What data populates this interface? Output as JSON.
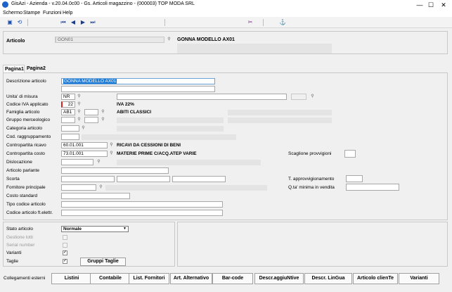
{
  "window": {
    "title": "GisAzi - Azienda - v.20.04.0c00 - Gs. Articoli magazzino - (000003) TOP MODA SRL",
    "minimize": "—",
    "maximize": "☐",
    "close": "✕"
  },
  "menu": [
    "Schermo",
    "Stampe",
    "Funzioni",
    "Help"
  ],
  "header": {
    "articolo_label": "Articolo",
    "articolo_code": "GON01",
    "articolo_desc": "GONNA MODELLO AX01"
  },
  "tabs": [
    "Pagina1",
    "Pagina2"
  ],
  "form": {
    "descrizione_label": "Descrizione articolo",
    "descrizione_value": "GONNA MODELLO AX01",
    "um_label": "Unita' di misura",
    "um_value": "NR",
    "iva_label": "Codice IVA applicato",
    "iva_value": "22",
    "iva_desc": "IVA 22%",
    "famiglia_label": "Famiglia articolo",
    "famiglia_value": "AB1",
    "famiglia_desc": "ABITI CLASSICI",
    "gruppo_label": "Gruppo merceologico",
    "categoria_label": "Categoria articolo",
    "raggruppamento_label": "Cod. raggruppamento",
    "ricavo_label": "Contropartita ricavo",
    "ricavo_value": "60.01.001",
    "ricavo_desc": "RICAVI DA CESSIONI DI BENI",
    "costo_label": "Contropartita costo",
    "costo_value": "73.01.001",
    "costo_desc": "MATERIE PRIME C/ACQ.ATEP VARIE",
    "scaglione_label": "Scaglione provvigioni",
    "dislocazione_label": "Dislocazione",
    "parlante_label": "Articolo parlante",
    "scorta_label": "Scorta",
    "approvvigionamento_label": "T. approvvigionamento",
    "fornitore_label": "Fornitore principale",
    "qta_minima_label": "Q.ta' minima in vendita",
    "costo_std_label": "Costo standard",
    "tipo_codice_label": "Tipo codice articolo",
    "codice_fe_label": "Codice articolo ft.elettr."
  },
  "bottom": {
    "stato_label": "Stato articolo",
    "stato_value": "Normale",
    "lotti_label": "Gestione lotti",
    "serial_label": "Serial number",
    "varianti_label": "Varianti",
    "taglie_label": "Taglie",
    "varianti_checked": "✓",
    "taglie_checked": "✓",
    "gruppi_taglie": "Gruppi Taglie"
  },
  "bottom_buttons": {
    "collegamenti": "Collegamenti esterni",
    "listini": "Listini",
    "contabile": "Contabile",
    "fornitori": "List. Fornitori",
    "alternativo": "Art. Alternativo",
    "barcode": "Bar-code",
    "descr_agg": "Descr.aggiuNtive",
    "descr_lingua": "Descr. LinGua",
    "articolo_cliente": "Articolo clienTe",
    "varianti": "Varianti"
  }
}
